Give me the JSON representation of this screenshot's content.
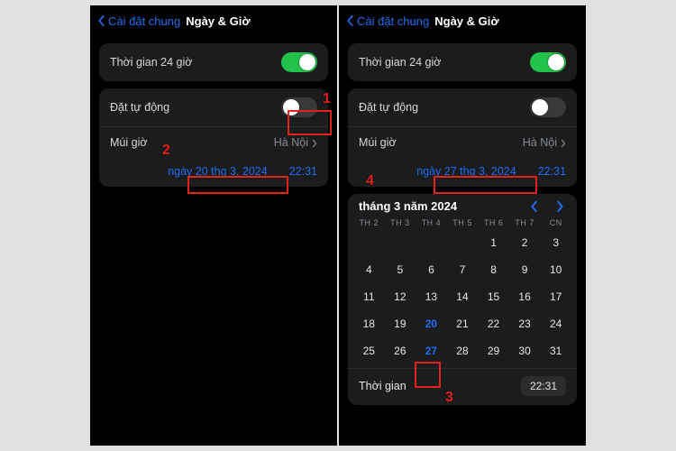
{
  "nav": {
    "back_label": "Cài đặt chung",
    "title": "Ngày & Giờ"
  },
  "settings": {
    "time24_label": "Thời gian 24 giờ",
    "auto_label": "Đặt tự động",
    "timezone_label": "Múi giờ",
    "timezone_value": "Hà Nội"
  },
  "left": {
    "date_text": "ngày 20 thg 3, 2024",
    "time_text": "22:31"
  },
  "right": {
    "date_text": "ngày 27 thg 3, 2024",
    "time_text": "22:31"
  },
  "calendar": {
    "month_label": "tháng 3 năm 2024",
    "dow": [
      "TH 2",
      "TH 3",
      "TH 4",
      "TH 5",
      "TH 6",
      "TH 7",
      "CN"
    ],
    "leading_blanks": 4,
    "days_in_month": 31,
    "today": 20,
    "selected": 27,
    "time_label": "Thời gian",
    "time_value": "22:31"
  },
  "annotations": {
    "n1": "1",
    "n2": "2",
    "n3": "3",
    "n4": "4"
  }
}
